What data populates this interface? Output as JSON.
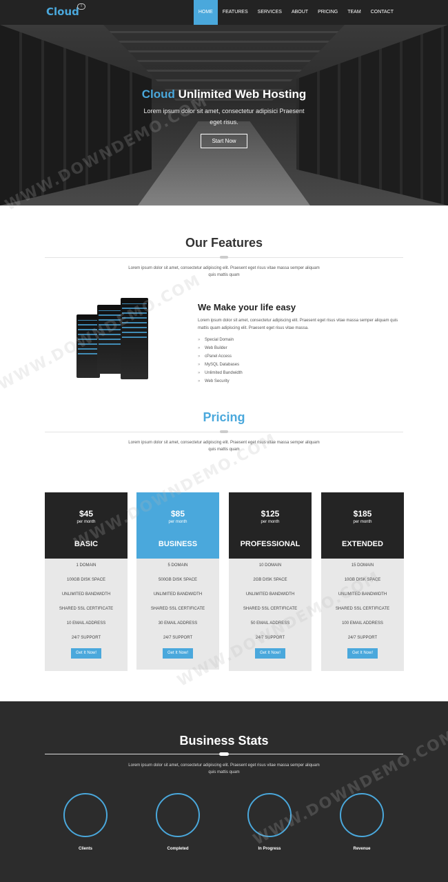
{
  "header": {
    "logo": "Cloud",
    "nav": [
      "HOME",
      "FEATURES",
      "SERVICES",
      "ABOUT",
      "PRICING",
      "TEAM",
      "CONTACT"
    ],
    "active_index": 0
  },
  "hero": {
    "title_accent": "Cloud",
    "title_rest": " Unlimited Web Hosting",
    "subtitle": "Lorem ipsum dolor sit amet, consectetur adipisici Praesent eget risus.",
    "button": "Start Now"
  },
  "features": {
    "title": "Our Features",
    "description": "Lorem ipsum dolor sit amet, consectetur adipiscing elit. Praesent eget risus vitae massa semper aliquam quis mattis quam",
    "heading": "We Make your life easy",
    "text": "Lorem ipsum dolor sit amet, consectetur adipiscing elit. Praesent eget risus vitae massa semper aliquam quis mattis quam adipiscing elit. Praesent eget risus vitae massa.",
    "list": [
      "Special Domain",
      "Web Builder",
      "cPanel Access",
      "MySQL Databases",
      "Unlimited Bandwidth",
      "Web Security"
    ]
  },
  "pricing": {
    "title": "Pricing",
    "description": "Lorem ipsum dolor sit amet, consectetur adipiscing elit. Praesent eget risus vitae massa semper aliquam quis mattis quam",
    "plans": [
      {
        "price": "$45",
        "per": "per month",
        "name": "BASIC",
        "domain": "1 DOMAIN",
        "disk": "100GB DISK SPACE",
        "bandwidth": "UNLIMITED BANDWIDTH",
        "ssl": "SHARED SSL CERTIFICATE",
        "email": "10 EMAIL ADDRESS",
        "support": "24/7 SUPPORT",
        "button": "Get It Now!"
      },
      {
        "price": "$85",
        "per": "per month",
        "name": "BUSINESS",
        "domain": "5 DOMAIN",
        "disk": "500GB DISK SPACE",
        "bandwidth": "UNLIMITED BANDWIDTH",
        "ssl": "SHARED SSL CERTIFICATE",
        "email": "30 EMAIL ADDRESS",
        "support": "24/7 SUPPORT",
        "button": "Get It Now!"
      },
      {
        "price": "$125",
        "per": "per month",
        "name": "PROFESSIONAL",
        "domain": "10 DOMAIN",
        "disk": "2GB DISK SPACE",
        "bandwidth": "UNLIMITED BANDWIDTH",
        "ssl": "SHARED SSL CERTIFICATE",
        "email": "50 EMAIL ADDRESS",
        "support": "24/7 SUPPORT",
        "button": "Get It Now!"
      },
      {
        "price": "$185",
        "per": "per month",
        "name": "EXTENDED",
        "domain": "15 DOMAIN",
        "disk": "10GB DISK SPACE",
        "bandwidth": "UNLIMITED BANDWIDTH",
        "ssl": "SHARED SSL CERTIFICATE",
        "email": "100 EMAIL ADDRESS",
        "support": "24/7 SUPPORT",
        "button": "Get It Now!"
      }
    ]
  },
  "stats": {
    "title": "Business Stats",
    "description": "Lorem ipsum dolor sit amet, consectetur adipiscing elit. Praesent eget risus vitae massa semper aliquam quis mattis quam",
    "labels": [
      "Clients",
      "Completed",
      "In Progress",
      "Revenue"
    ]
  },
  "watermark": "WWW.DOWNDEMO.COM",
  "colors": {
    "accent": "#4aa8dc",
    "dark": "#242424"
  }
}
